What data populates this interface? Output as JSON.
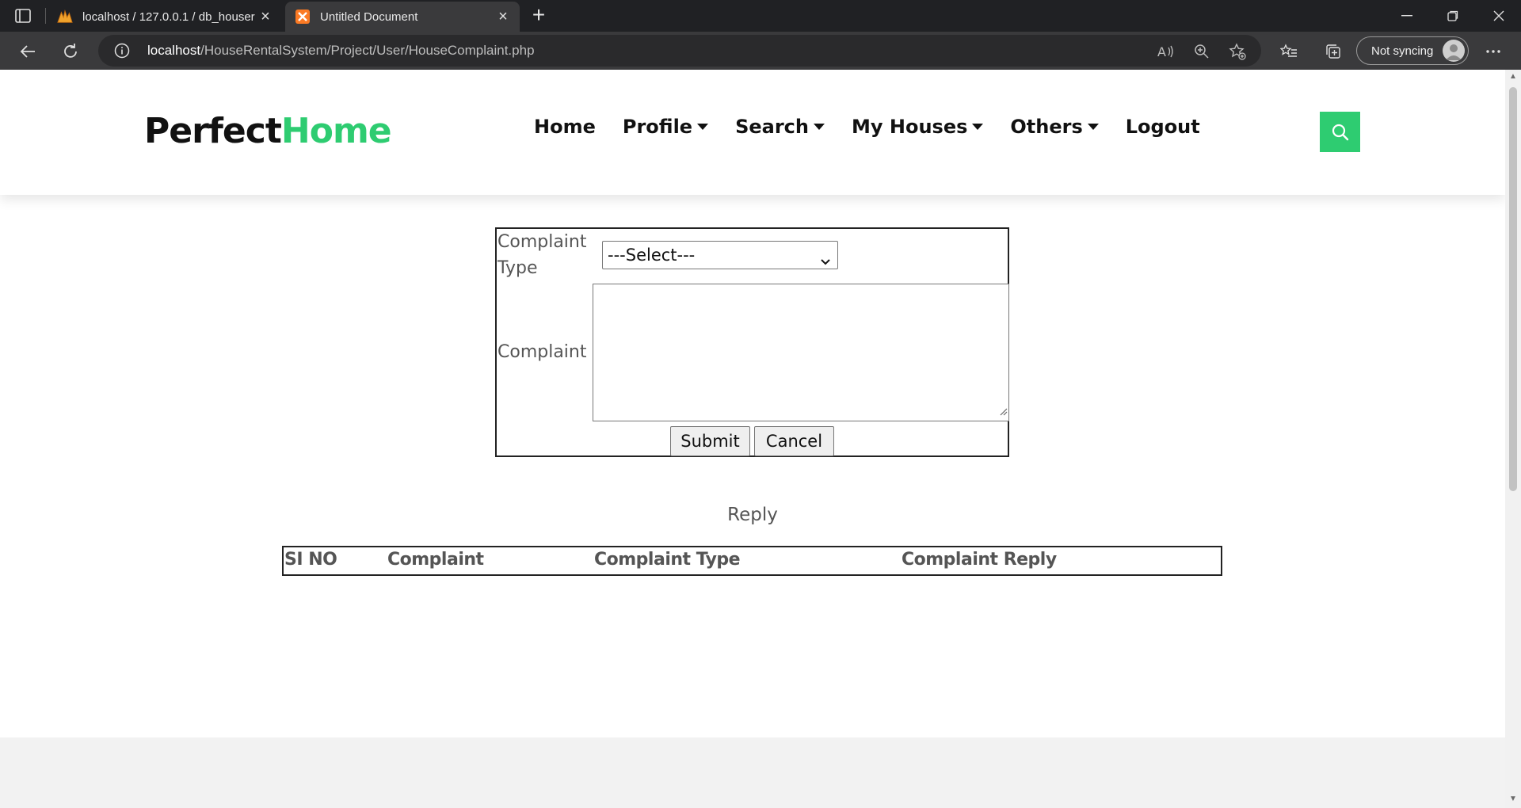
{
  "browser": {
    "tabs": [
      {
        "title": "localhost / 127.0.0.1 / db_houser",
        "icon": "phpmyadmin-icon",
        "active": false
      },
      {
        "title": "Untitled Document",
        "icon": "xampp-icon",
        "active": true
      }
    ],
    "url_host": "localhost",
    "url_path": "/HouseRentalSystem/Project/User/HouseComplaint.php",
    "sync_label": "Not syncing"
  },
  "site": {
    "logo_main": "Perfect",
    "logo_accent": "Home",
    "accent_color": "#2ecc71",
    "nav": [
      {
        "label": "Home",
        "dropdown": false
      },
      {
        "label": "Profile",
        "dropdown": true
      },
      {
        "label": "Search",
        "dropdown": true
      },
      {
        "label": "My Houses",
        "dropdown": true
      },
      {
        "label": "Others",
        "dropdown": true
      },
      {
        "label": "Logout",
        "dropdown": false
      }
    ]
  },
  "form": {
    "complaint_type_label_line1": "Complaint",
    "complaint_type_label_line2": "Type",
    "complaint_type_selected": "---Select---",
    "complaint_label": "Complaint",
    "complaint_value": "",
    "submit_label": "Submit",
    "cancel_label": "Cancel"
  },
  "reply": {
    "title": "Reply",
    "columns": [
      "SI NO",
      "Complaint",
      "Complaint Type",
      "Complaint Reply"
    ],
    "rows": []
  }
}
